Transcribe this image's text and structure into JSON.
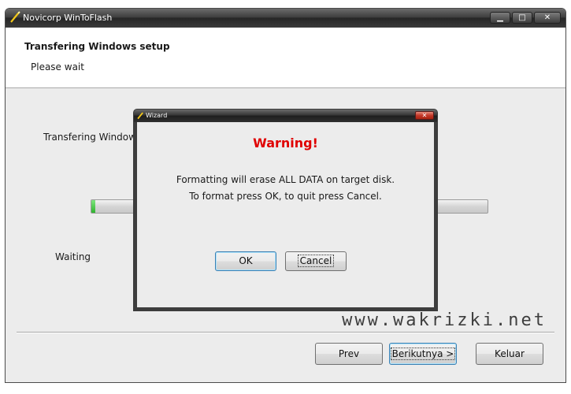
{
  "window": {
    "title": "Novicorp WinToFlash",
    "controls": {
      "minimize": "▁",
      "maximize": "□",
      "close": "✕"
    }
  },
  "header": {
    "title": "Transfering Windows setup",
    "subtitle": "Please wait"
  },
  "main": {
    "status_label": "Transfering Windows s",
    "progress_fraction": 0.01,
    "waiting_label": "Waiting"
  },
  "watermark": "www.wakrizki.net",
  "buttons": {
    "prev": "Prev",
    "next": "Berikutnya >",
    "quit": "Keluar"
  },
  "dialog": {
    "title": "Wizard",
    "close": "✕",
    "heading": "Warning!",
    "line1": "Formatting will erase ALL DATA on target disk.",
    "line2": "To format press OK, to quit press Cancel.",
    "ok": "OK",
    "cancel": "Cancel"
  },
  "colors": {
    "warning": "#e00000",
    "progress": "#2fb32f",
    "title_bar": "#2a2a2a"
  }
}
